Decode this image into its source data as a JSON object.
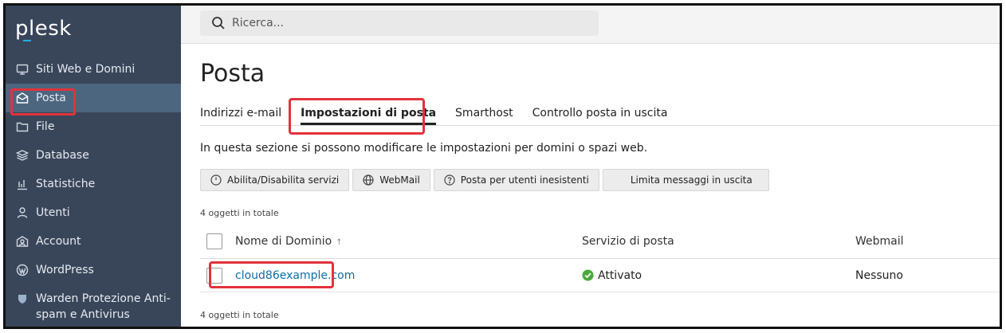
{
  "brand": {
    "logo": "plesk"
  },
  "sidebar": {
    "items": [
      {
        "label": "Siti Web e Domini",
        "icon": "monitor-icon"
      },
      {
        "label": "Posta",
        "icon": "mail-icon"
      },
      {
        "label": "File",
        "icon": "folder-icon"
      },
      {
        "label": "Database",
        "icon": "database-icon"
      },
      {
        "label": "Statistiche",
        "icon": "bar-chart-icon"
      },
      {
        "label": "Utenti",
        "icon": "user-icon"
      },
      {
        "label": "Account",
        "icon": "account-icon"
      },
      {
        "label": "WordPress",
        "icon": "wordpress-icon"
      },
      {
        "label": "Warden Protezione Anti-spam e Antivirus",
        "icon": "shield-icon"
      }
    ]
  },
  "search": {
    "placeholder": "Ricerca..."
  },
  "page": {
    "title": "Posta",
    "tabs": [
      {
        "label": "Indirizzi e-mail"
      },
      {
        "label": "Impostazioni di posta"
      },
      {
        "label": "Smarthost"
      },
      {
        "label": "Controllo posta in uscita"
      }
    ],
    "description": "In questa sezione si possono modificare le impostazioni per domini o spazi web.",
    "toolbar": {
      "toggle_services": "Abilita/Disabilita servizi",
      "webmail": "WebMail",
      "nonexistent_users": "Posta per utenti inesistenti",
      "limit_outgoing": "Limita messaggi in uscita"
    },
    "count_top": "4 oggetti in totale",
    "count_bottom": "4 oggetti in totale"
  },
  "table": {
    "headers": {
      "name": "Nome di Dominio",
      "sort": "↑",
      "mail_service": "Servizio di posta",
      "webmail": "Webmail"
    },
    "rows": [
      {
        "domain": "cloud86example.com",
        "mail_service": "Attivato",
        "webmail": "Nessuno"
      }
    ]
  },
  "colors": {
    "sidebar_bg": "#39465a",
    "active_item": "#4d6680",
    "link": "#0c6fa8",
    "highlight": "#e2323b",
    "ok_green": "#4aa93a"
  }
}
